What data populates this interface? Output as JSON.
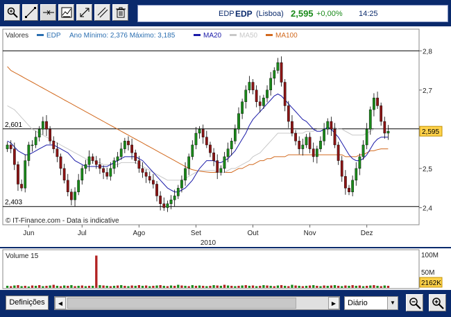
{
  "header": {
    "symbol": "EDP",
    "symbol_bold": "EDP",
    "exchange": "(Lisboa)",
    "price": "2,595",
    "change": "+0,00%",
    "time": "14:25"
  },
  "toolbar": {
    "tools": [
      {
        "name": "zoom-icon"
      },
      {
        "name": "trendline-icon"
      },
      {
        "name": "crosshair-icon"
      },
      {
        "name": "indicator-icon"
      },
      {
        "name": "expand-icon"
      },
      {
        "name": "parallel-lines-icon"
      },
      {
        "name": "trash-icon"
      }
    ]
  },
  "legend": {
    "values_label": "Valores",
    "series_name": "EDP",
    "range_text": "Ano Mínimo: 2,376 Máximo: 3,185",
    "ma20": "MA20",
    "ma50": "MA50",
    "ma100": "MA100"
  },
  "colors": {
    "price_up": "#1a8a1a",
    "price_down": "#8b1414",
    "ma20": "#1a1aa8",
    "ma50": "#c8c8c8",
    "ma100": "#d2691e",
    "price_tag_bg": "#ffd24a",
    "volume_bar": "#b22222"
  },
  "chart_data": {
    "type": "candlestick",
    "x_labels": [
      "Jun",
      "Jul",
      "Ago",
      "Set",
      "Out",
      "Nov",
      "Dez"
    ],
    "year_label": "2010",
    "y_ticks": [
      "2,8",
      "2,7",
      "2,6",
      "2,5",
      "2,4"
    ],
    "ylim": [
      2.36,
      2.82
    ],
    "reference_lines": [
      {
        "label": "2,601",
        "value": 2.601
      },
      {
        "label": "2,403",
        "value": 2.403
      },
      {
        "label": "",
        "value": 2.8
      }
    ],
    "current_price_label": "2,595",
    "current_price": 2.595,
    "watermark": "© IT-Finance.com - Data is indicative",
    "legend_position": "top-left",
    "closes": [
      2.56,
      2.55,
      2.51,
      2.46,
      2.45,
      2.52,
      2.56,
      2.56,
      2.58,
      2.6,
      2.62,
      2.6,
      2.57,
      2.55,
      2.53,
      2.5,
      2.47,
      2.44,
      2.42,
      2.44,
      2.47,
      2.5,
      2.51,
      2.53,
      2.52,
      2.51,
      2.5,
      2.49,
      2.48,
      2.5,
      2.52,
      2.53,
      2.55,
      2.57,
      2.56,
      2.54,
      2.52,
      2.5,
      2.49,
      2.48,
      2.47,
      2.46,
      2.43,
      2.41,
      2.4,
      2.41,
      2.42,
      2.43,
      2.45,
      2.47,
      2.5,
      2.53,
      2.56,
      2.59,
      2.6,
      2.58,
      2.56,
      2.54,
      2.52,
      2.49,
      2.5,
      2.53,
      2.55,
      2.57,
      2.6,
      2.64,
      2.67,
      2.7,
      2.72,
      2.7,
      2.67,
      2.66,
      2.68,
      2.7,
      2.73,
      2.75,
      2.77,
      2.72,
      2.66,
      2.62,
      2.59,
      2.57,
      2.55,
      2.56,
      2.58,
      2.55,
      2.53,
      2.55,
      2.57,
      2.6,
      2.62,
      2.6,
      2.56,
      2.52,
      2.48,
      2.45,
      2.44,
      2.47,
      2.5,
      2.53,
      2.56,
      2.6,
      2.65,
      2.68,
      2.66,
      2.62,
      2.59,
      2.595
    ],
    "ma20": [
      2.57,
      2.565,
      2.555,
      2.545,
      2.54,
      2.535,
      2.535,
      2.54,
      2.545,
      2.55,
      2.555,
      2.56,
      2.56,
      2.56,
      2.555,
      2.55,
      2.545,
      2.54,
      2.53,
      2.52,
      2.515,
      2.51,
      2.505,
      2.505,
      2.505,
      2.505,
      2.505,
      2.505,
      2.505,
      2.51,
      2.515,
      2.52,
      2.525,
      2.53,
      2.53,
      2.53,
      2.53,
      2.525,
      2.52,
      2.51,
      2.5,
      2.49,
      2.48,
      2.47,
      2.46,
      2.45,
      2.445,
      2.44,
      2.44,
      2.445,
      2.45,
      2.46,
      2.47,
      2.485,
      2.5,
      2.51,
      2.52,
      2.52,
      2.52,
      2.515,
      2.515,
      2.52,
      2.525,
      2.535,
      2.545,
      2.56,
      2.575,
      2.59,
      2.61,
      2.625,
      2.635,
      2.645,
      2.655,
      2.665,
      2.675,
      2.685,
      2.69,
      2.685,
      2.675,
      2.665,
      2.655,
      2.645,
      2.635,
      2.625,
      2.62,
      2.61,
      2.6,
      2.595,
      2.595,
      2.6,
      2.605,
      2.6,
      2.59,
      2.58,
      2.565,
      2.55,
      2.535,
      2.525,
      2.52,
      2.52,
      2.525,
      2.535,
      2.55,
      2.565,
      2.575,
      2.58,
      2.58,
      2.58
    ],
    "ma50": [
      2.66,
      2.655,
      2.65,
      2.64,
      2.63,
      2.62,
      2.61,
      2.6,
      2.595,
      2.59,
      2.585,
      2.58,
      2.575,
      2.57,
      2.565,
      2.56,
      2.555,
      2.55,
      2.545,
      2.54,
      2.535,
      2.53,
      2.525,
      2.52,
      2.52,
      2.515,
      2.515,
      2.51,
      2.51,
      2.51,
      2.51,
      2.51,
      2.515,
      2.515,
      2.515,
      2.515,
      2.515,
      2.51,
      2.505,
      2.5,
      2.495,
      2.49,
      2.485,
      2.48,
      2.475,
      2.47,
      2.47,
      2.47,
      2.47,
      2.47,
      2.475,
      2.48,
      2.485,
      2.49,
      2.495,
      2.495,
      2.495,
      2.495,
      2.495,
      2.49,
      2.49,
      2.49,
      2.495,
      2.5,
      2.5,
      2.505,
      2.51,
      2.515,
      2.52,
      2.53,
      2.535,
      2.54,
      2.55,
      2.56,
      2.57,
      2.58,
      2.59,
      2.59,
      2.59,
      2.59,
      2.59,
      2.59,
      2.59,
      2.59,
      2.595,
      2.595,
      2.595,
      2.6,
      2.6,
      2.6,
      2.605,
      2.605,
      2.605,
      2.6,
      2.6,
      2.595,
      2.59,
      2.585,
      2.585,
      2.585,
      2.585,
      2.59,
      2.595,
      2.6,
      2.6,
      2.6,
      2.6,
      2.6
    ],
    "ma100": [
      2.76,
      2.75,
      2.745,
      2.74,
      2.735,
      2.73,
      2.725,
      2.72,
      2.715,
      2.71,
      2.705,
      2.7,
      2.695,
      2.69,
      2.685,
      2.68,
      2.675,
      2.67,
      2.665,
      2.66,
      2.655,
      2.65,
      2.645,
      2.64,
      2.635,
      2.63,
      2.625,
      2.62,
      2.615,
      2.61,
      2.605,
      2.6,
      2.595,
      2.59,
      2.585,
      2.58,
      2.575,
      2.57,
      2.565,
      2.56,
      2.555,
      2.55,
      2.545,
      2.54,
      2.535,
      2.53,
      2.525,
      2.52,
      2.515,
      2.51,
      2.505,
      2.5,
      2.497,
      2.495,
      2.493,
      2.492,
      2.491,
      2.49,
      2.49,
      2.49,
      2.49,
      2.49,
      2.49,
      2.49,
      2.495,
      2.5,
      2.5,
      2.505,
      2.51,
      2.51,
      2.515,
      2.52,
      2.52,
      2.525,
      2.525,
      2.53,
      2.53,
      2.53,
      2.53,
      2.535,
      2.535,
      2.535,
      2.535,
      2.535,
      2.535,
      2.535,
      2.535,
      2.535,
      2.535,
      2.535,
      2.535,
      2.535,
      2.535,
      2.535,
      2.535,
      2.53,
      2.53,
      2.53,
      2.53,
      2.535,
      2.535,
      2.54,
      2.545,
      2.545,
      2.548,
      2.55,
      2.55,
      2.55
    ]
  },
  "volume": {
    "label": "Volume 15",
    "y_ticks": [
      "100M",
      "50M"
    ],
    "current_label": "2162K",
    "values": [
      6,
      5,
      7,
      8,
      5,
      6,
      4,
      7,
      6,
      8,
      5,
      6,
      7,
      9,
      6,
      5,
      7,
      6,
      8,
      5,
      6,
      7,
      5,
      6,
      6,
      95,
      8,
      7,
      6,
      5,
      6,
      7,
      8,
      6,
      5,
      7,
      6,
      8,
      6,
      7,
      5,
      6,
      7,
      8,
      6,
      5,
      7,
      6,
      9,
      7,
      6,
      5,
      8,
      6,
      7,
      6,
      5,
      6,
      8,
      7,
      6,
      9,
      7,
      6,
      5,
      6,
      7,
      8,
      6,
      7,
      5,
      6,
      8,
      7,
      6,
      5,
      7,
      8,
      6,
      5,
      9,
      7,
      6,
      5,
      6,
      7,
      8,
      6,
      5,
      7,
      6,
      7,
      8,
      6,
      5,
      7,
      6,
      8,
      6,
      7,
      5,
      6,
      7,
      8,
      6,
      5,
      7,
      6
    ]
  },
  "footer": {
    "settings_button": "Definições",
    "period_selected": "Diário"
  }
}
